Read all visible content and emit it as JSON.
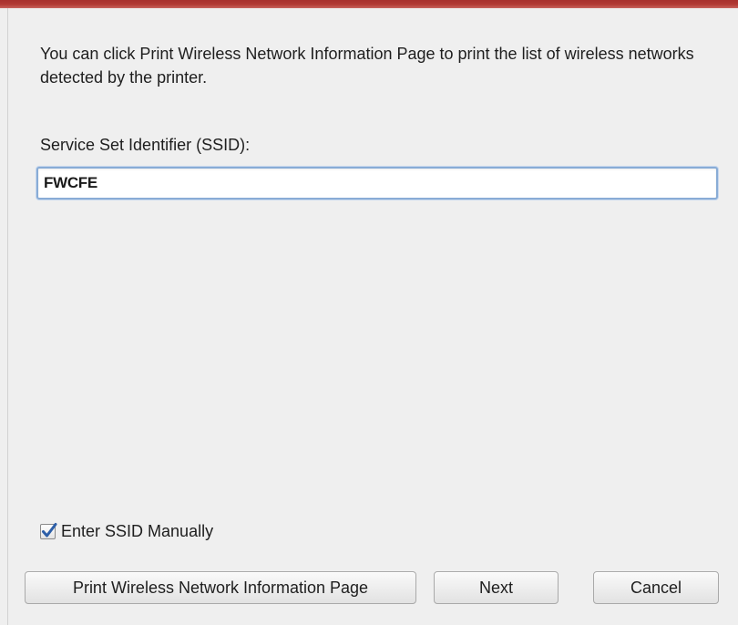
{
  "intro_text": "You can click Print Wireless Network Information Page to print the list of wireless networks detected by the printer.",
  "ssid": {
    "label": "Service Set Identifier (SSID):",
    "value": "FWCFE"
  },
  "manual_entry": {
    "label": "Enter SSID Manually",
    "checked": true
  },
  "buttons": {
    "print": "Print Wireless Network Information Page",
    "next": "Next",
    "cancel": "Cancel"
  },
  "colors": {
    "title_strip": "#b23a35",
    "focus_border": "#89acd6",
    "checkmark": "#2d5fa8"
  }
}
